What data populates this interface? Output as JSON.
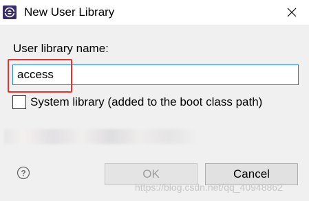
{
  "window": {
    "title": "New User Library",
    "app_icon": "eclipse-icon",
    "close_icon": "close-icon"
  },
  "form": {
    "name_label": "User library name:",
    "name_value": "access",
    "system_library_label": "System library (added to the boot class path)",
    "system_library_checked": false
  },
  "buttons": {
    "help_icon": "help-icon",
    "ok_label": "OK",
    "ok_enabled": false,
    "cancel_label": "Cancel"
  },
  "watermark": "https://blog.csdn.net/qq_40948862",
  "colors": {
    "input_focus_border": "#2a84c7",
    "annotation_red": "#e8322d",
    "dialog_background": "#f0f0f0"
  }
}
